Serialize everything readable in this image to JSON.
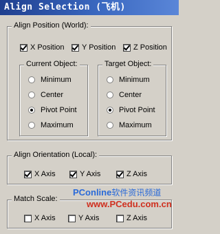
{
  "window": {
    "title": "Align Selection (飞机)"
  },
  "align_position": {
    "title": "Align Position (World):",
    "axes": [
      {
        "label": "X Position",
        "checked": true
      },
      {
        "label": "Y Position",
        "checked": true
      },
      {
        "label": "Z Position",
        "checked": true
      }
    ]
  },
  "current_object": {
    "title": "Current Object:",
    "options": [
      "Minimum",
      "Center",
      "Pivot Point",
      "Maximum"
    ],
    "selected": "Pivot Point"
  },
  "target_object": {
    "title": "Target Object:",
    "options": [
      "Minimum",
      "Center",
      "Pivot Point",
      "Maximum"
    ],
    "selected": "Pivot Point"
  },
  "align_orientation": {
    "title": "Align Orientation (Local):",
    "axes": [
      {
        "label": "X Axis",
        "checked": true
      },
      {
        "label": "Y Axis",
        "checked": true
      },
      {
        "label": "Z Axis",
        "checked": true
      }
    ]
  },
  "match_scale": {
    "title": "Match Scale:",
    "axes": [
      {
        "label": "X Axis",
        "checked": false
      },
      {
        "label": "Y Axis",
        "checked": false
      },
      {
        "label": "Z Axis",
        "checked": false
      }
    ]
  },
  "watermark": {
    "brand": "PConline",
    "brand_suffix": "软件资讯频道",
    "url": "www.PCedu.com.cn"
  }
}
